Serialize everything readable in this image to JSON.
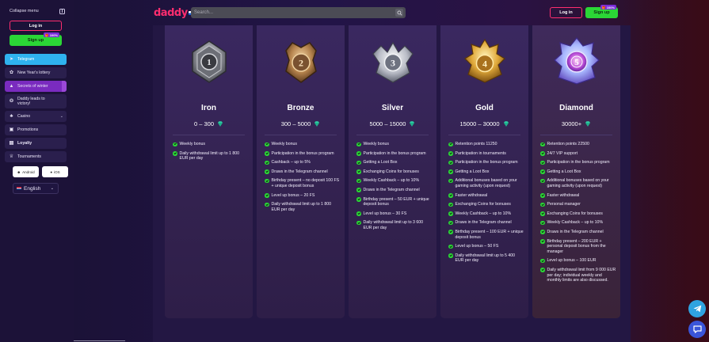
{
  "sidebar": {
    "collapse_label": "Collapse menu",
    "login_label": "Log in",
    "signup_label": "Sign up",
    "signup_badge": "100%",
    "items": [
      {
        "label": "Telegram",
        "icon": "telegram-icon"
      },
      {
        "label": "New Year's lottery",
        "icon": "lottery-icon"
      },
      {
        "label": "Secrets of winter",
        "icon": "tree-icon"
      },
      {
        "label": "Daddy leads to victory!",
        "icon": "trophy-icon"
      },
      {
        "label": "Casino",
        "icon": "casino-icon"
      },
      {
        "label": "Promotions",
        "icon": "gift-icon"
      },
      {
        "label": "Loyalty",
        "icon": "loyalty-icon"
      },
      {
        "label": "Tournaments",
        "icon": "tournament-icon"
      }
    ],
    "apps": {
      "android": "Android",
      "ios": "iOS"
    },
    "language": "English"
  },
  "header": {
    "logo": "daddy",
    "search_placeholder": "Search...",
    "login_label": "Log in",
    "signup_label": "Sign up",
    "signup_badge": "100%"
  },
  "loyalty": {
    "levels": [
      {
        "name": "Iron",
        "range": "0 – 300",
        "perks": [
          "Weekly bonus",
          "Daily withdrawal limit up to 1 800 EUR per day"
        ]
      },
      {
        "name": "Bronze",
        "range": "300 – 5000",
        "perks": [
          "Weekly bonus",
          "Participation in the bonus program",
          "Cashback – up to 5%",
          "Draws in the Telegram channel",
          "Birthday present – no deposit 100 FS + unique deposit bonus",
          "Level up bonus – 20 FS",
          "Daily withdrawal limit up to 1 800 EUR per day"
        ]
      },
      {
        "name": "Silver",
        "range": "5000 – 15000",
        "perks": [
          "Weekly bonus",
          "Participation in the bonus program",
          "Getting a Loot Box",
          "Exchanging Coins for bonuses",
          "Weekly Cashback – up to 10%",
          "Draws in the Telegram channel",
          "Birthday present – 50 EUR + unique deposit bonus",
          "Level up bonus – 30 FS",
          "Daily withdrawal limit up to 3 600 EUR per day"
        ]
      },
      {
        "name": "Gold",
        "range": "15000 – 30000",
        "perks": [
          "Retention points 11250",
          "Participation in tournaments",
          "Participation in the bonus program",
          "Getting a Loot Box",
          "Additional bonuses based on your gaming activity (upon request)",
          "Faster withdrawal",
          "Exchanging Coins for bonuses",
          "Weekly Cashback – up to 10%",
          "Draws in the Telegram channel",
          "Birthday present – 100 EUR + unique deposit bonus",
          "Level up bonus – 50 FS",
          "Daily withdrawal limit up to 5 400 EUR per day"
        ]
      },
      {
        "name": "Diamond",
        "range": "30000+",
        "perks": [
          "Retention points 22500",
          "24/7 VIP support",
          "Participation in the bonus program",
          "Getting a Loot Box",
          "Additional bonuses based on your gaming activity (upon request)",
          "Faster withdrawal",
          "Personal manager",
          "Exchanging Coins for bonuses",
          "Weekly Cashback – up to 10%",
          "Draws in the Telegram channel",
          "Birthday present – 200 EUR + personal deposit bonus from the manager",
          "Level up bonus – 100 EUR",
          "Daily withdrawal limit from 9 000 EUR per day; individual weekly and monthly limits are also discussed."
        ]
      }
    ]
  },
  "colors": {
    "accent_pink": "#ff2d6f",
    "accent_green": "#2bd636",
    "accent_blue": "#2fb2ef",
    "accent_purple": "#7a2bbf"
  }
}
